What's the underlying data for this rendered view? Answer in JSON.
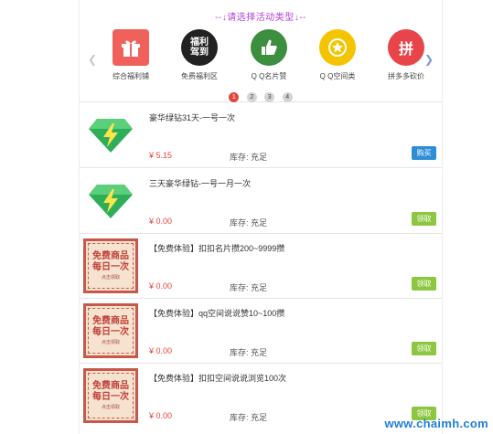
{
  "header": {
    "prompt": "--↓请选择活动类型↓--",
    "nav_left_icon": "chevron-left",
    "nav_right_icon": "chevron-right"
  },
  "categories": [
    {
      "label": "综合福利铺",
      "icon": "gift-icon",
      "icon_text": "",
      "color": "#f0615c"
    },
    {
      "label": "免费福利区",
      "icon": "free-welfare-icon",
      "icon_text": "福利",
      "icon_text2": "驾到",
      "color": "#222222"
    },
    {
      "label": "Q Q名片赞",
      "icon": "thumbs-up-icon",
      "icon_text": "",
      "color": "#3c8f3e"
    },
    {
      "label": "Q Q空间类",
      "icon": "star-icon",
      "icon_text": "",
      "color": "#f4c400"
    },
    {
      "label": "拼多多砍价",
      "icon": "pinduoduo-icon",
      "icon_text": "拼",
      "color": "#e8454a"
    }
  ],
  "pager": [
    "1",
    "2",
    "3",
    "4"
  ],
  "products": [
    {
      "title": "豪华绿钻31天-一号一次",
      "price": "¥ 5.15",
      "stock_label": "库存:",
      "stock_value": "充足",
      "action": "购买",
      "thumb": "green-diamond-icon"
    },
    {
      "title": "三天豪华绿钻-一号一月一次",
      "price": "¥ 0.00",
      "stock_label": "库存:",
      "stock_value": "充足",
      "action": "领取",
      "thumb": "green-diamond-icon"
    },
    {
      "title": "【免费体验】扣扣名片攒200~9999攒",
      "price": "¥ 0.00",
      "stock_label": "库存:",
      "stock_value": "充足",
      "action": "领取",
      "thumb": "free-card-icon"
    },
    {
      "title": "【免费体验】qq空间说说赞10~100攒",
      "price": "¥ 0.00",
      "stock_label": "库存:",
      "stock_value": "充足",
      "action": "领取",
      "thumb": "free-card-icon"
    },
    {
      "title": "【免费体验】扣扣空间说说浏览100次",
      "price": "¥ 0.00",
      "stock_label": "库存:",
      "stock_value": "充足",
      "action": "领取",
      "thumb": "free-card-icon"
    }
  ],
  "free_card": {
    "line1": "免费商品",
    "line2": "每日一次",
    "small": "点击领取"
  },
  "watermark": "www.chaimh.com",
  "colors": {
    "accent_purple": "#b03fd8",
    "price_red": "#e8463c",
    "buy_blue": "#2d8ed6",
    "claim_green": "#8dc63f",
    "active_dot": "#e0463d"
  }
}
